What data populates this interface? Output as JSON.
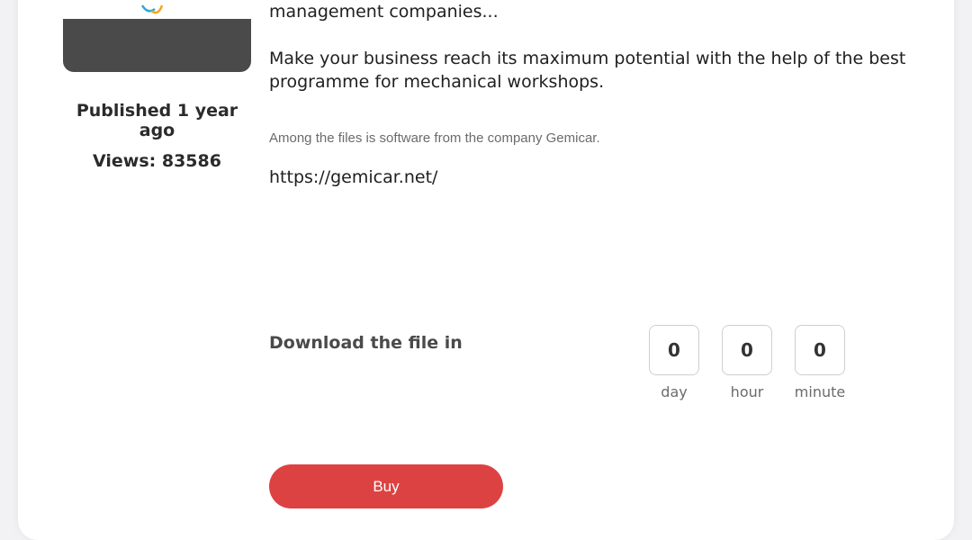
{
  "post": {
    "published": "Published 1 year ago",
    "views": "Views: 83586"
  },
  "description": {
    "para1": "management companies...",
    "para2": "Make your business reach its maximum potential with the help of the best programme for mechanical workshops.",
    "note": "Among the files is software from the company Gemicar.",
    "link": "https://gemicar.net/"
  },
  "download": {
    "label": "Download the file in",
    "countdown": [
      {
        "value": "0",
        "unit": "day"
      },
      {
        "value": "0",
        "unit": "hour"
      },
      {
        "value": "0",
        "unit": "minute"
      }
    ],
    "buy_label": "Buy"
  },
  "colors": {
    "buy_button": "#dd4242",
    "thumbnail_bg": "#4a4a4a"
  }
}
